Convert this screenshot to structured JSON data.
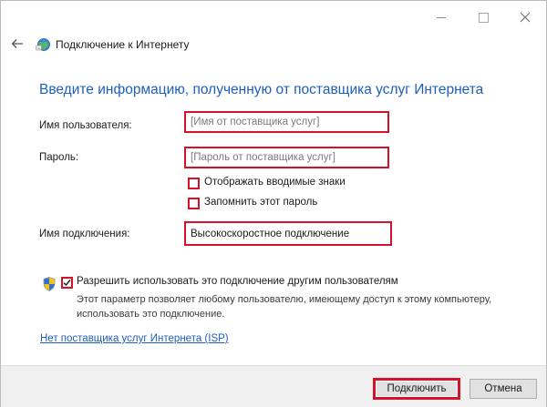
{
  "window": {
    "title": "Подключение к Интернету",
    "minimize_icon": "minimize-icon",
    "maximize_icon": "maximize-icon",
    "close_icon": "close-icon",
    "back_icon": "back-arrow-icon",
    "app_icon": "network-globe-icon"
  },
  "main": {
    "heading": "Введите информацию, полученную от поставщика услуг Интернета",
    "username": {
      "label": "Имя пользователя:",
      "placeholder": "[Имя от поставщика услуг]",
      "value": ""
    },
    "password": {
      "label": "Пароль:",
      "placeholder": "[Пароль от поставщика услуг]",
      "value": ""
    },
    "show_chars": {
      "label": "Отображать вводимые знаки",
      "checked": false
    },
    "remember_password": {
      "label": "Запомнить этот пароль",
      "checked": false
    },
    "connection_name": {
      "label": "Имя подключения:",
      "value": "Высокоскоростное подключение"
    },
    "allow_others": {
      "label": "Разрешить использовать это подключение другим пользователям",
      "checked": true,
      "description": "Этот параметр позволяет любому пользователю, имеющему доступ к этому компьютеру, использовать это подключение.",
      "icon": "uac-shield-icon"
    },
    "isp_link": "Нет поставщика услуг Интернета (ISP)"
  },
  "footer": {
    "connect_label": "Подключить",
    "cancel_label": "Отмена"
  },
  "colors": {
    "accent": "#1d5fbf",
    "highlight": "#d4122a"
  }
}
